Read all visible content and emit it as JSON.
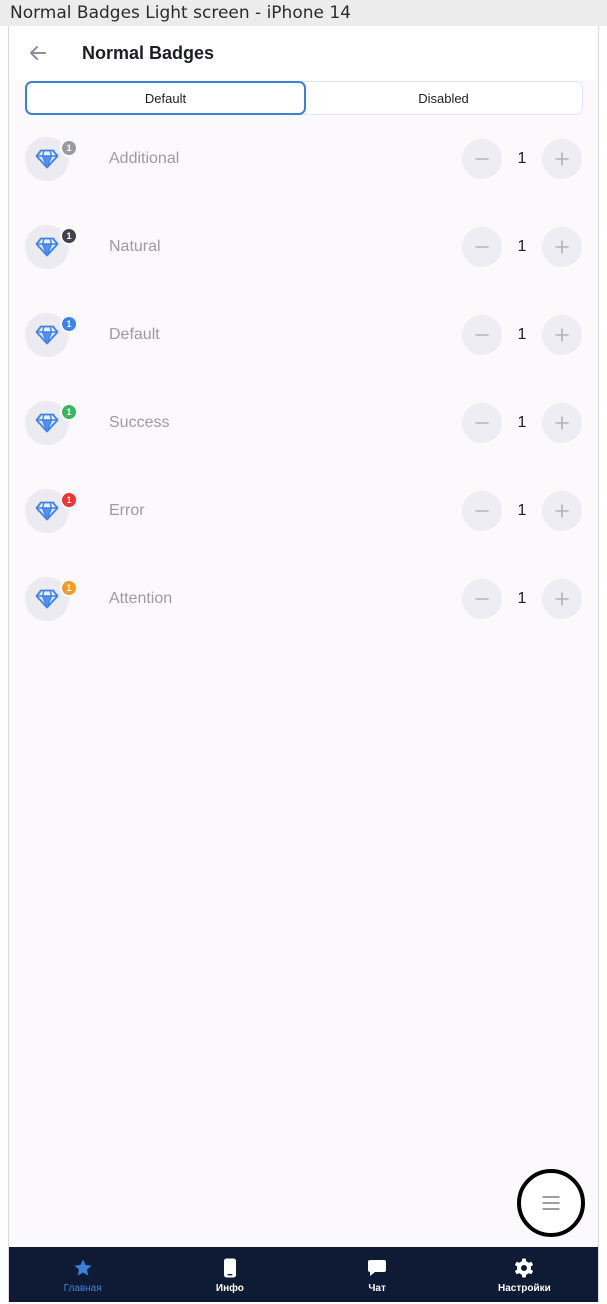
{
  "frame": {
    "title": "Normal Badges Light screen - iPhone 14"
  },
  "header": {
    "title": "Normal Badges"
  },
  "tabs": [
    {
      "label": "Default",
      "active": true
    },
    {
      "label": "Disabled",
      "active": false
    }
  ],
  "rows": [
    {
      "label": "Additional",
      "badge": "1",
      "badge_color": "#9a9aa2",
      "value": "1"
    },
    {
      "label": "Natural",
      "badge": "1",
      "badge_color": "#41434d",
      "value": "1"
    },
    {
      "label": "Default",
      "badge": "1",
      "badge_color": "#3b82f0",
      "value": "1"
    },
    {
      "label": "Success",
      "badge": "1",
      "badge_color": "#3bb55e",
      "value": "1"
    },
    {
      "label": "Error",
      "badge": "1",
      "badge_color": "#f03434",
      "value": "1"
    },
    {
      "label": "Attention",
      "badge": "1",
      "badge_color": "#f59a2c",
      "value": "1"
    }
  ],
  "row_icon": "diamond-icon",
  "fab": {
    "icon": "menu-icon"
  },
  "bottom_nav": [
    {
      "label": "Главная",
      "icon": "star-icon",
      "active": true
    },
    {
      "label": "Инфо",
      "icon": "phone-icon",
      "active": false
    },
    {
      "label": "Чат",
      "icon": "chat-icon",
      "active": false
    },
    {
      "label": "Настройки",
      "icon": "gear-icon",
      "active": false
    }
  ],
  "colors": {
    "accent": "#3b82d6",
    "nav_background": "#0f1b34",
    "screen_background": "#fcf9fd"
  }
}
